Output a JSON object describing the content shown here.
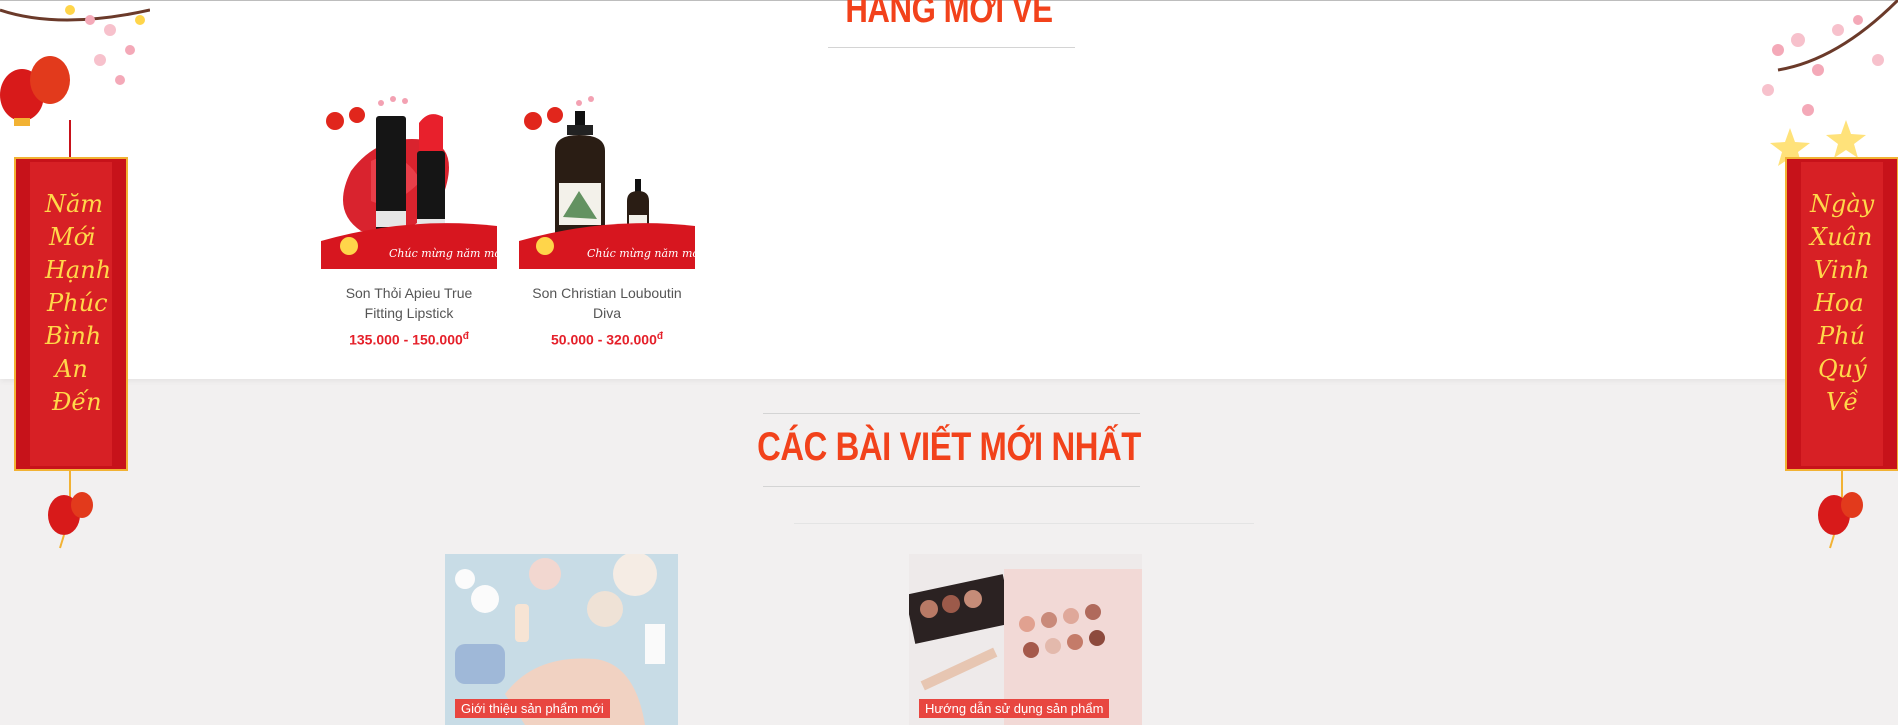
{
  "sections": {
    "new_arrivals_title": "HÀNG MỚI VỀ",
    "latest_posts_title": "CÁC BÀI VIẾT MỚI NHẤT"
  },
  "products": [
    {
      "name": "Son Thỏi Apieu True Fitting Lipstick",
      "price": "135.000 - 150.000",
      "currency": "đ",
      "image_caption": "Chúc mừng năm mới"
    },
    {
      "name": "Son Christian Louboutin Diva",
      "price": "50.000 - 320.000",
      "currency": "đ",
      "image_caption": "Chúc mừng năm mới"
    }
  ],
  "posts": [
    {
      "category": "Giới thiệu sản phẩm mới"
    },
    {
      "category": "Hướng dẫn sử dụng sản phẩm"
    }
  ],
  "banners": {
    "left_lines": [
      "Năm",
      "Mới",
      "Hạnh",
      "Phúc",
      "Bình",
      "An",
      "Đến"
    ],
    "right_lines": [
      "Ngày",
      "Xuân",
      "Vinh",
      "Hoa",
      "Phú",
      "Quý",
      "Về"
    ]
  },
  "colors": {
    "accent": "#f2421b",
    "price": "#e5202a",
    "tag": "#e84640",
    "banner": "#d2141a",
    "banner_text": "#ffd84a"
  }
}
